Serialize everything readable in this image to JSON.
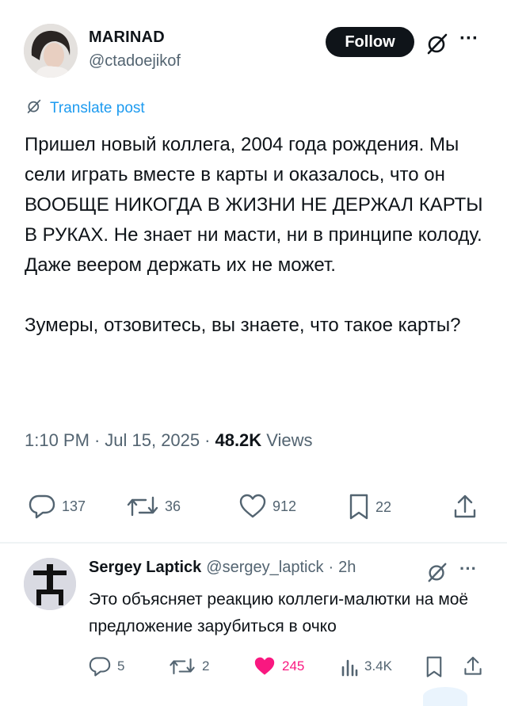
{
  "post": {
    "author_name": "MARINAD",
    "author_handle": "@ctadoejikof",
    "follow_label": "Follow",
    "translate_label": "Translate post",
    "text_p1": "Пришел новый коллега, 2004 года рождения. Мы сели играть вместе в карты и оказалось, что он ВООБЩЕ НИКОГДА В ЖИЗНИ НЕ ДЕРЖАЛ КАРТЫ В РУКАХ. Не знает ни масти, ни в принципе колоду. Даже веером держать их не может.",
    "text_p2": "Зумеры, отзовитесь, вы знаете, что такое карты?",
    "time": "1:10 PM",
    "date": "Jul 15, 2025",
    "dot": "·",
    "views_count": "48.2K",
    "views_label": "Views",
    "actions": {
      "replies": "137",
      "reposts": "36",
      "likes": "912",
      "bookmarks": "22"
    }
  },
  "reply": {
    "author_name": "Sergey Laptick",
    "author_handle": "@sergey_laptick",
    "dot": "·",
    "age": "2h",
    "text": "Это объясняет реакцию коллеги-малютки на моё предложение зарубиться в очко",
    "actions": {
      "replies": "5",
      "reposts": "2",
      "likes": "245",
      "views": "3.4K"
    }
  },
  "colors": {
    "accent": "#1d9bf0",
    "like_active": "#f91880",
    "text": "#0f1419",
    "muted": "#536471"
  },
  "icons": [
    "grok-icon",
    "more-icon",
    "reply-icon",
    "repost-icon",
    "like-icon",
    "bookmark-icon",
    "share-icon",
    "views-icon"
  ]
}
